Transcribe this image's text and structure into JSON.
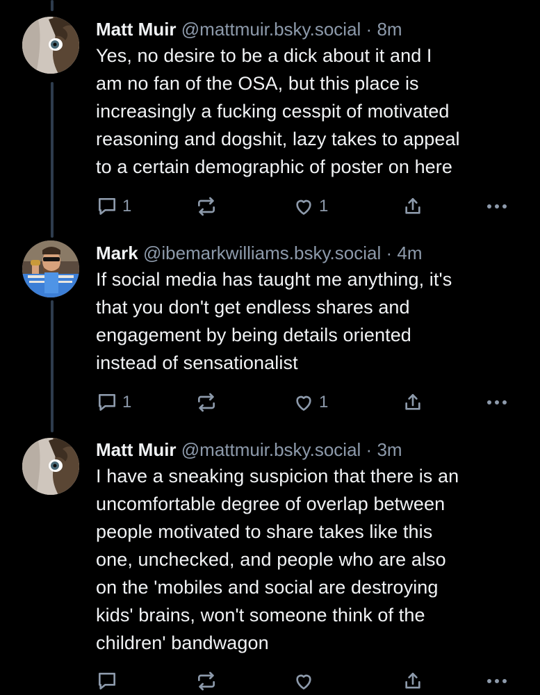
{
  "posts": [
    {
      "display_name": "Matt Muir",
      "handle": "@mattmuir.bsky.social",
      "separator": "·",
      "time": "8m",
      "lines": [
        "Yes, no desire to be a dick about it and I",
        "am no fan of the OSA, but this place is",
        "increasingly a fucking cesspit of motivated",
        "reasoning and dogshit, lazy takes to appeal",
        "to a certain demographic of poster on here"
      ],
      "reply_count": "1",
      "repost_count": "",
      "like_count": "1",
      "avatar_icon": "avatar-matt-muir"
    },
    {
      "display_name": "Mark",
      "handle": "@ibemarkwilliams.bsky.social",
      "separator": "·",
      "time": "4m",
      "lines": [
        "If social media has taught me anything, it's",
        "that you don't get endless shares and",
        "engagement by being details oriented",
        "instead of sensationalist"
      ],
      "reply_count": "1",
      "repost_count": "",
      "like_count": "1",
      "avatar_icon": "avatar-mark"
    },
    {
      "display_name": "Matt Muir",
      "handle": "@mattmuir.bsky.social",
      "separator": "·",
      "time": "3m",
      "lines": [
        "I have a sneaking suspicion that there is an",
        "uncomfortable degree of overlap between",
        "people motivated to share takes like this",
        "one, unchecked, and people who are also",
        "on the 'mobiles and social are destroying",
        "kids' brains, won't someone think of the",
        "children' bandwagon"
      ],
      "reply_count": "",
      "repost_count": "",
      "like_count": "",
      "avatar_icon": "avatar-matt-muir"
    }
  ],
  "icons": {
    "reply": "reply-icon",
    "repost": "repost-icon",
    "like": "like-icon",
    "share": "share-icon",
    "more": "more-icon"
  },
  "colors": {
    "background": "#000000",
    "text": "#f1f3f5",
    "muted": "#8d9aab",
    "thread_line": "#2e3c4d"
  }
}
